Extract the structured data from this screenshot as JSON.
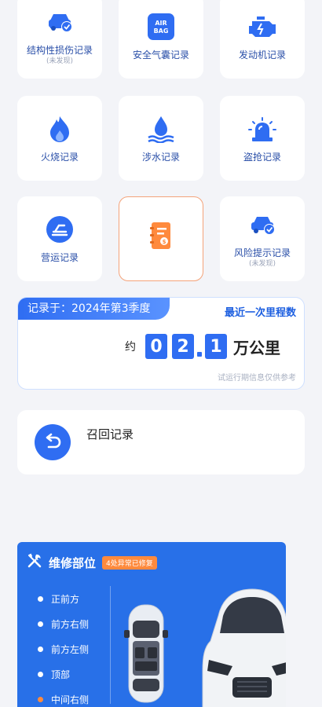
{
  "grid": [
    {
      "label": "结构性损伤记录",
      "sub": "(未发现)",
      "icon": "car-damage-icon"
    },
    {
      "label": "安全气囊记录",
      "sub": "",
      "icon": "airbag-icon",
      "icon_text": "AIR\nBAG"
    },
    {
      "label": "发动机记录",
      "sub": "",
      "icon": "engine-icon"
    },
    {
      "label": "火烧记录",
      "sub": "",
      "icon": "fire-icon"
    },
    {
      "label": "涉水记录",
      "sub": "",
      "icon": "water-icon"
    },
    {
      "label": "盗抢记录",
      "sub": "",
      "icon": "alarm-icon"
    },
    {
      "label": "营运记录",
      "sub": "",
      "icon": "commercial-icon"
    },
    {
      "label": "",
      "sub": "",
      "icon": "notebook-icon"
    },
    {
      "label": "风险提示记录",
      "sub": "(未发现)",
      "icon": "risk-car-icon"
    }
  ],
  "mileage": {
    "record_tag": "记录于：2024年第3季度",
    "recent_label": "最近一次里程数",
    "prefix": "约",
    "digits": [
      "0",
      "2",
      "1"
    ],
    "unit": "万公里",
    "note": "试运行期信息仅供参考"
  },
  "recall": {
    "title": "召回记录"
  },
  "repair": {
    "title": "维修部位",
    "badge": "4处异常已修复",
    "parts": [
      "正前方",
      "前方右侧",
      "前方左侧",
      "顶部",
      "中间右侧"
    ]
  },
  "colors": {
    "primary": "#2f6df2",
    "accent": "#ff8a3d",
    "label": "#2a4fa8"
  }
}
